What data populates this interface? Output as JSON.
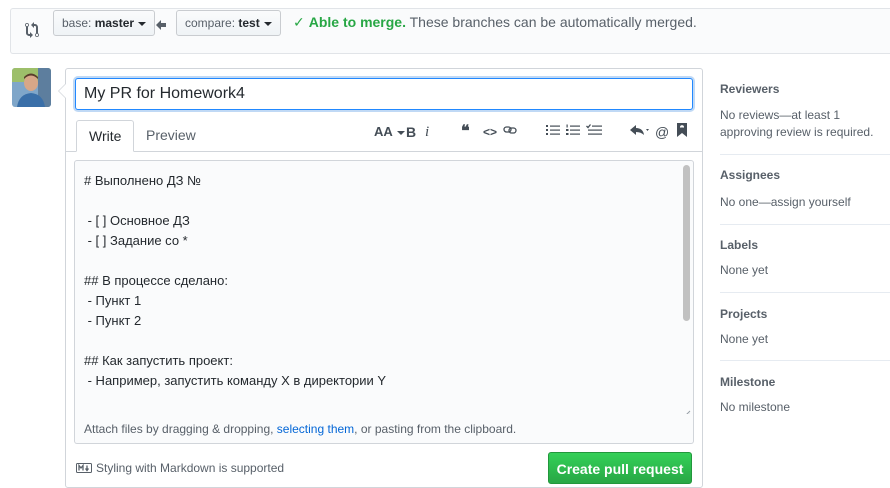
{
  "compare": {
    "base_prefix": "base:",
    "base_branch": "master",
    "compare_prefix": "compare:",
    "compare_branch": "test",
    "merge_ok": "Able to merge.",
    "merge_msg": "These branches can be automatically merged."
  },
  "form": {
    "title_value": "My PR for Homework4",
    "tabs": [
      "Write",
      "Preview"
    ],
    "toolbar": {
      "heading": "AA",
      "bold": "B",
      "italic": "i",
      "quote": "66",
      "code": "<>",
      "mention": "@"
    },
    "body_lines": [
      "# Выполнено ДЗ №",
      "",
      " - [ ] Основное ДЗ",
      " - [ ] Задание со *",
      "",
      "## В процессе сделано:",
      " - Пункт 1",
      " - Пункт 2",
      "",
      "## Как запустить проект:",
      " - Например, запустить команду X в директории Y",
      ""
    ],
    "attach_prefix": "Attach files by dragging & dropping, ",
    "attach_link": "selecting them",
    "attach_suffix": ", or pasting from the clipboard.",
    "markdown_note": "Styling with Markdown is supported",
    "submit_label": "Create pull request"
  },
  "sidebar": {
    "reviewers": {
      "heading": "Reviewers",
      "text": "No reviews—at least 1 approving review is required."
    },
    "assignees": {
      "heading": "Assignees",
      "text": "No one—assign yourself"
    },
    "labels": {
      "heading": "Labels",
      "text": "None yet"
    },
    "projects": {
      "heading": "Projects",
      "text": "None yet"
    },
    "milestone": {
      "heading": "Milestone",
      "text": "No milestone"
    }
  },
  "colors": {
    "accent": "#0366d6",
    "success": "#28a745",
    "border": "#d1d5da"
  }
}
